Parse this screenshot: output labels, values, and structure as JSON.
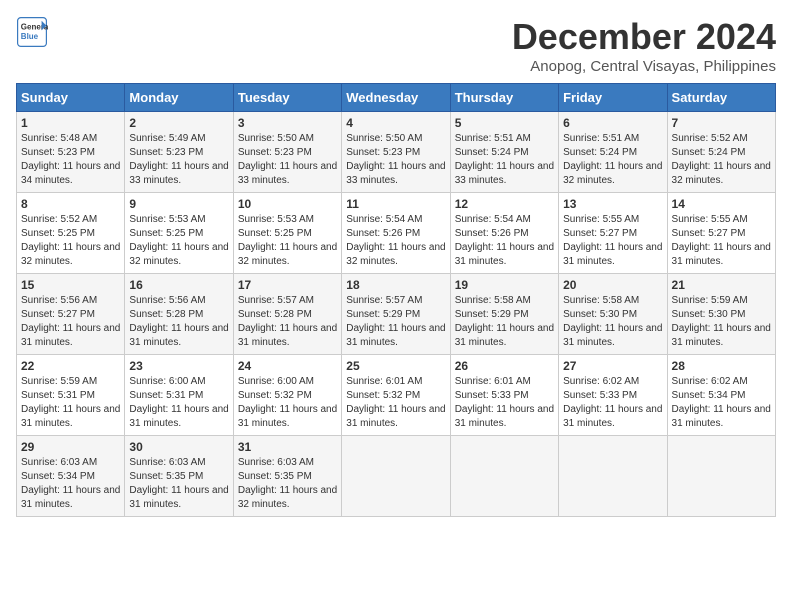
{
  "logo": {
    "line1": "General",
    "line2": "Blue"
  },
  "title": "December 2024",
  "location": "Anopog, Central Visayas, Philippines",
  "days_of_week": [
    "Sunday",
    "Monday",
    "Tuesday",
    "Wednesday",
    "Thursday",
    "Friday",
    "Saturday"
  ],
  "weeks": [
    [
      {
        "day": "1",
        "sunrise": "Sunrise: 5:48 AM",
        "sunset": "Sunset: 5:23 PM",
        "daylight": "Daylight: 11 hours and 34 minutes."
      },
      {
        "day": "2",
        "sunrise": "Sunrise: 5:49 AM",
        "sunset": "Sunset: 5:23 PM",
        "daylight": "Daylight: 11 hours and 33 minutes."
      },
      {
        "day": "3",
        "sunrise": "Sunrise: 5:50 AM",
        "sunset": "Sunset: 5:23 PM",
        "daylight": "Daylight: 11 hours and 33 minutes."
      },
      {
        "day": "4",
        "sunrise": "Sunrise: 5:50 AM",
        "sunset": "Sunset: 5:23 PM",
        "daylight": "Daylight: 11 hours and 33 minutes."
      },
      {
        "day": "5",
        "sunrise": "Sunrise: 5:51 AM",
        "sunset": "Sunset: 5:24 PM",
        "daylight": "Daylight: 11 hours and 33 minutes."
      },
      {
        "day": "6",
        "sunrise": "Sunrise: 5:51 AM",
        "sunset": "Sunset: 5:24 PM",
        "daylight": "Daylight: 11 hours and 32 minutes."
      },
      {
        "day": "7",
        "sunrise": "Sunrise: 5:52 AM",
        "sunset": "Sunset: 5:24 PM",
        "daylight": "Daylight: 11 hours and 32 minutes."
      }
    ],
    [
      {
        "day": "8",
        "sunrise": "Sunrise: 5:52 AM",
        "sunset": "Sunset: 5:25 PM",
        "daylight": "Daylight: 11 hours and 32 minutes."
      },
      {
        "day": "9",
        "sunrise": "Sunrise: 5:53 AM",
        "sunset": "Sunset: 5:25 PM",
        "daylight": "Daylight: 11 hours and 32 minutes."
      },
      {
        "day": "10",
        "sunrise": "Sunrise: 5:53 AM",
        "sunset": "Sunset: 5:25 PM",
        "daylight": "Daylight: 11 hours and 32 minutes."
      },
      {
        "day": "11",
        "sunrise": "Sunrise: 5:54 AM",
        "sunset": "Sunset: 5:26 PM",
        "daylight": "Daylight: 11 hours and 32 minutes."
      },
      {
        "day": "12",
        "sunrise": "Sunrise: 5:54 AM",
        "sunset": "Sunset: 5:26 PM",
        "daylight": "Daylight: 11 hours and 31 minutes."
      },
      {
        "day": "13",
        "sunrise": "Sunrise: 5:55 AM",
        "sunset": "Sunset: 5:27 PM",
        "daylight": "Daylight: 11 hours and 31 minutes."
      },
      {
        "day": "14",
        "sunrise": "Sunrise: 5:55 AM",
        "sunset": "Sunset: 5:27 PM",
        "daylight": "Daylight: 11 hours and 31 minutes."
      }
    ],
    [
      {
        "day": "15",
        "sunrise": "Sunrise: 5:56 AM",
        "sunset": "Sunset: 5:27 PM",
        "daylight": "Daylight: 11 hours and 31 minutes."
      },
      {
        "day": "16",
        "sunrise": "Sunrise: 5:56 AM",
        "sunset": "Sunset: 5:28 PM",
        "daylight": "Daylight: 11 hours and 31 minutes."
      },
      {
        "day": "17",
        "sunrise": "Sunrise: 5:57 AM",
        "sunset": "Sunset: 5:28 PM",
        "daylight": "Daylight: 11 hours and 31 minutes."
      },
      {
        "day": "18",
        "sunrise": "Sunrise: 5:57 AM",
        "sunset": "Sunset: 5:29 PM",
        "daylight": "Daylight: 11 hours and 31 minutes."
      },
      {
        "day": "19",
        "sunrise": "Sunrise: 5:58 AM",
        "sunset": "Sunset: 5:29 PM",
        "daylight": "Daylight: 11 hours and 31 minutes."
      },
      {
        "day": "20",
        "sunrise": "Sunrise: 5:58 AM",
        "sunset": "Sunset: 5:30 PM",
        "daylight": "Daylight: 11 hours and 31 minutes."
      },
      {
        "day": "21",
        "sunrise": "Sunrise: 5:59 AM",
        "sunset": "Sunset: 5:30 PM",
        "daylight": "Daylight: 11 hours and 31 minutes."
      }
    ],
    [
      {
        "day": "22",
        "sunrise": "Sunrise: 5:59 AM",
        "sunset": "Sunset: 5:31 PM",
        "daylight": "Daylight: 11 hours and 31 minutes."
      },
      {
        "day": "23",
        "sunrise": "Sunrise: 6:00 AM",
        "sunset": "Sunset: 5:31 PM",
        "daylight": "Daylight: 11 hours and 31 minutes."
      },
      {
        "day": "24",
        "sunrise": "Sunrise: 6:00 AM",
        "sunset": "Sunset: 5:32 PM",
        "daylight": "Daylight: 11 hours and 31 minutes."
      },
      {
        "day": "25",
        "sunrise": "Sunrise: 6:01 AM",
        "sunset": "Sunset: 5:32 PM",
        "daylight": "Daylight: 11 hours and 31 minutes."
      },
      {
        "day": "26",
        "sunrise": "Sunrise: 6:01 AM",
        "sunset": "Sunset: 5:33 PM",
        "daylight": "Daylight: 11 hours and 31 minutes."
      },
      {
        "day": "27",
        "sunrise": "Sunrise: 6:02 AM",
        "sunset": "Sunset: 5:33 PM",
        "daylight": "Daylight: 11 hours and 31 minutes."
      },
      {
        "day": "28",
        "sunrise": "Sunrise: 6:02 AM",
        "sunset": "Sunset: 5:34 PM",
        "daylight": "Daylight: 11 hours and 31 minutes."
      }
    ],
    [
      {
        "day": "29",
        "sunrise": "Sunrise: 6:03 AM",
        "sunset": "Sunset: 5:34 PM",
        "daylight": "Daylight: 11 hours and 31 minutes."
      },
      {
        "day": "30",
        "sunrise": "Sunrise: 6:03 AM",
        "sunset": "Sunset: 5:35 PM",
        "daylight": "Daylight: 11 hours and 31 minutes."
      },
      {
        "day": "31",
        "sunrise": "Sunrise: 6:03 AM",
        "sunset": "Sunset: 5:35 PM",
        "daylight": "Daylight: 11 hours and 32 minutes."
      },
      null,
      null,
      null,
      null
    ]
  ]
}
